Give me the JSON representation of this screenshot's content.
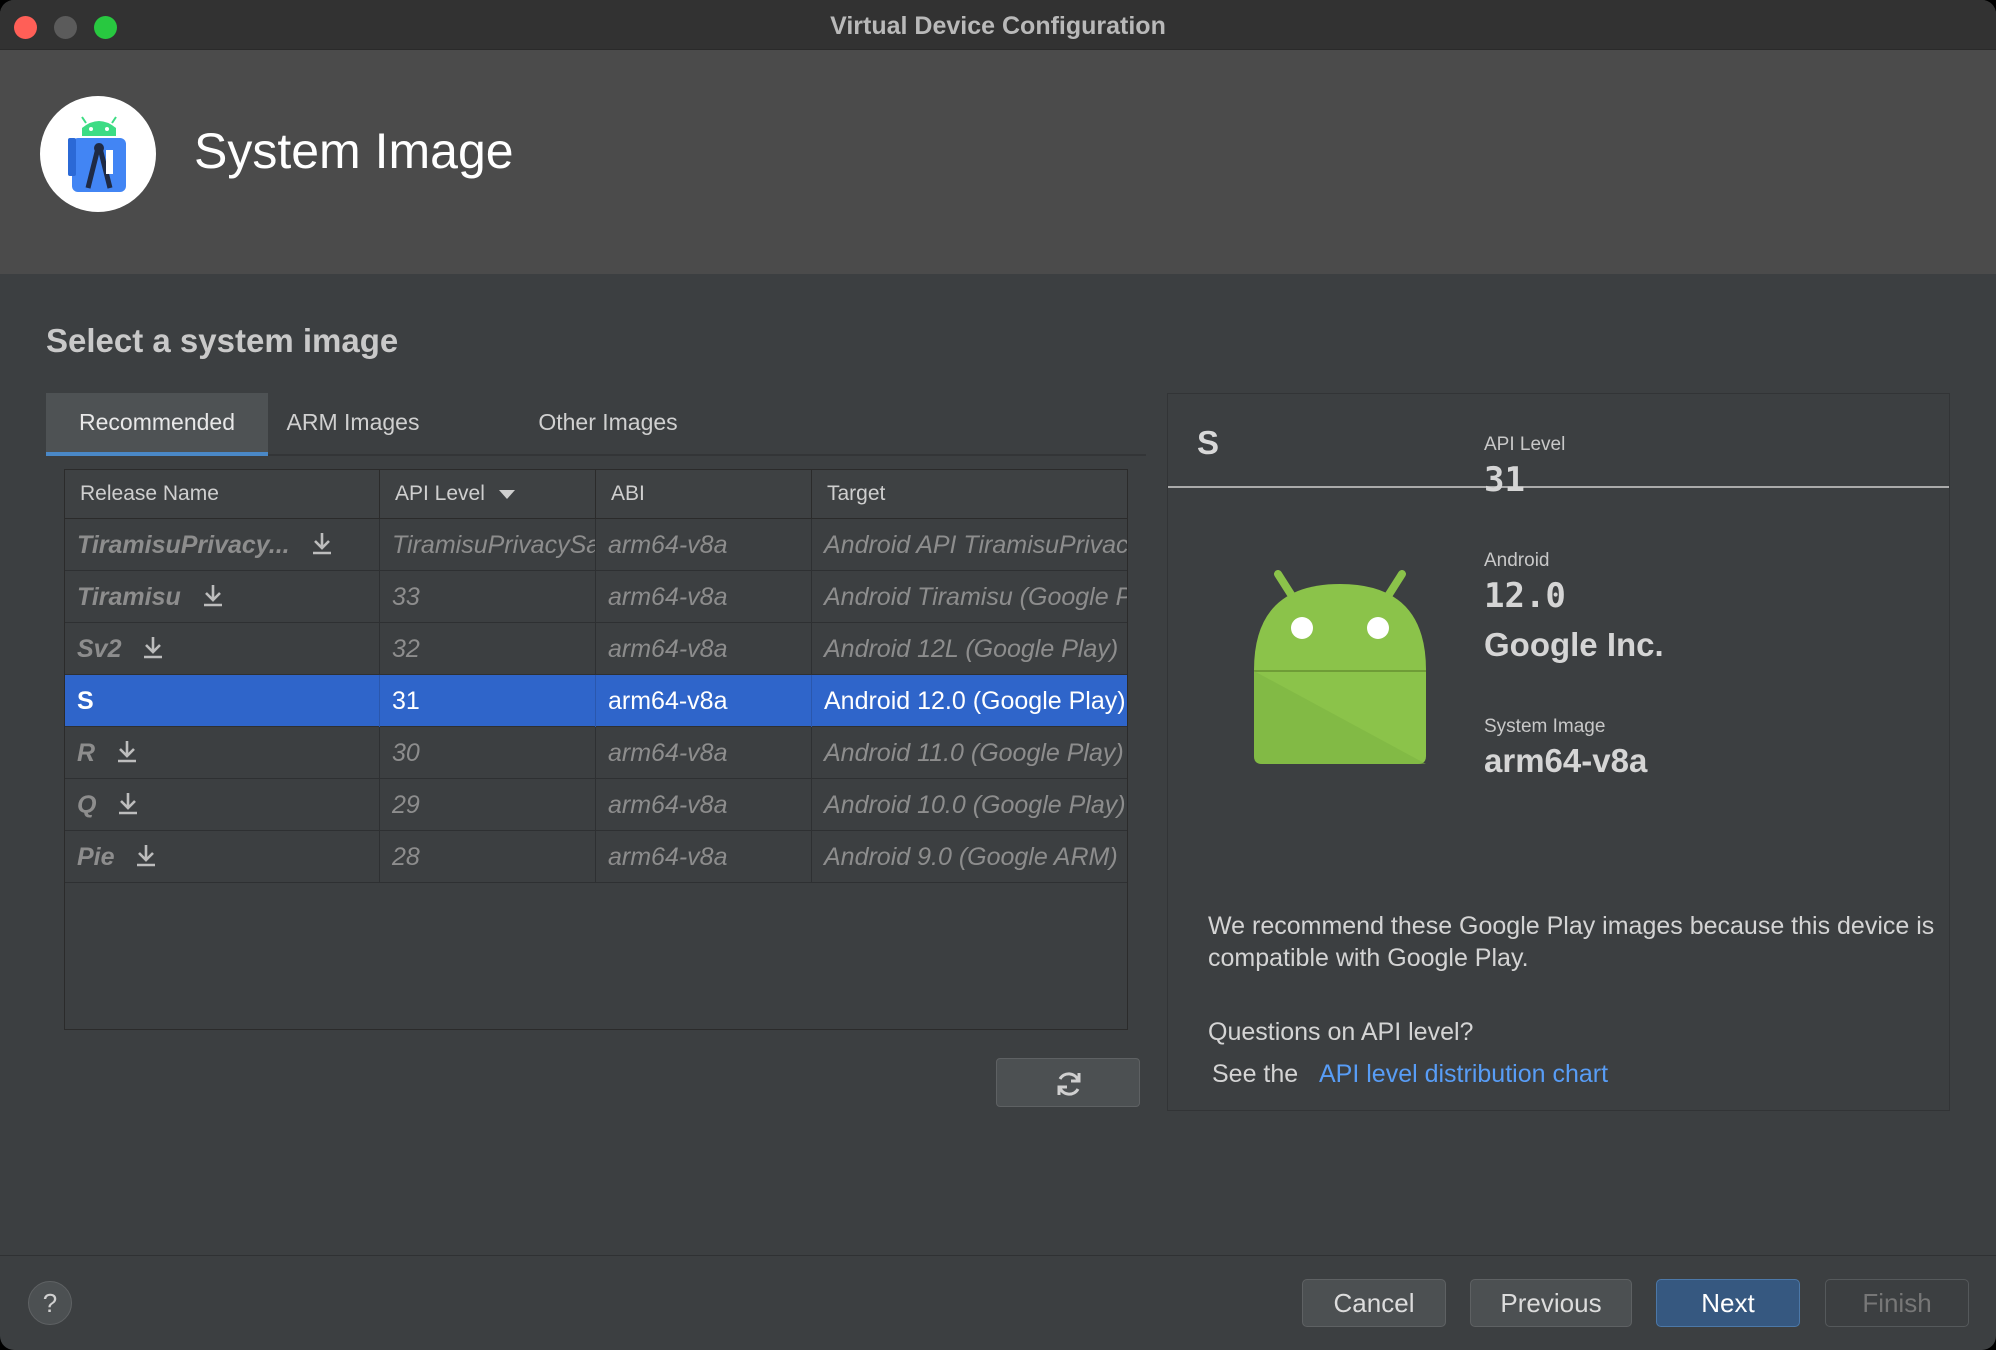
{
  "window": {
    "title": "Virtual Device Configuration"
  },
  "header": {
    "title": "System Image",
    "logo_icon": "android-studio-icon"
  },
  "section_title": "Select a system image",
  "tabs": [
    {
      "label": "Recommended",
      "active": true
    },
    {
      "label": "ARM Images",
      "active": false
    },
    {
      "label": "Other Images",
      "active": false
    }
  ],
  "table": {
    "columns": [
      "Release Name",
      "API Level",
      "ABI",
      "Target"
    ],
    "sort_column": "API Level",
    "rows": [
      {
        "name": "TiramisuPrivacy...",
        "api": "TiramisuPrivacySandbox",
        "abi": "arm64-v8a",
        "target": "Android API TiramisuPrivacySandbox",
        "download": true,
        "selected": false
      },
      {
        "name": "Tiramisu",
        "api": "33",
        "abi": "arm64-v8a",
        "target": "Android Tiramisu (Google Play)",
        "download": true,
        "selected": false
      },
      {
        "name": "Sv2",
        "api": "32",
        "abi": "arm64-v8a",
        "target": "Android 12L (Google Play)",
        "download": true,
        "selected": false
      },
      {
        "name": "S",
        "api": "31",
        "abi": "arm64-v8a",
        "target": "Android 12.0 (Google Play)",
        "download": false,
        "selected": true
      },
      {
        "name": "R",
        "api": "30",
        "abi": "arm64-v8a",
        "target": "Android 11.0 (Google Play)",
        "download": true,
        "selected": false
      },
      {
        "name": "Q",
        "api": "29",
        "abi": "arm64-v8a",
        "target": "Android 10.0 (Google Play)",
        "download": true,
        "selected": false
      },
      {
        "name": "Pie",
        "api": "28",
        "abi": "arm64-v8a",
        "target": "Android 9.0 (Google ARM)",
        "download": true,
        "selected": false
      }
    ]
  },
  "detail": {
    "title": "S",
    "api_level_label": "API Level",
    "api_level": "31",
    "android_label": "Android",
    "android_version": "12.0",
    "vendor": "Google Inc.",
    "system_image_label": "System Image",
    "system_image": "arm64-v8a",
    "recommendation": "We recommend these Google Play images because this device is compatible with Google Play.",
    "question": "Questions on API level?",
    "see_prefix": "See the",
    "link_text": "API level distribution chart"
  },
  "footer": {
    "help": "?",
    "cancel": "Cancel",
    "previous": "Previous",
    "next": "Next",
    "finish": "Finish"
  },
  "colors": {
    "accent": "#2f65ca",
    "link": "#589df6",
    "android_green": "#8bc34a"
  }
}
